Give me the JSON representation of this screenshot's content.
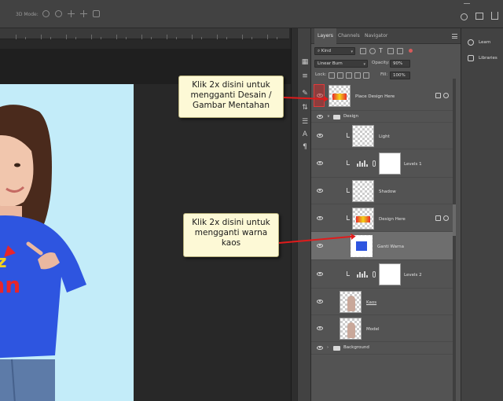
{
  "toolbar": {
    "mode_label": "3D Mode:"
  },
  "panel": {
    "tabs": [
      {
        "label": "Layers",
        "active": true
      },
      {
        "label": "Channels",
        "active": false
      },
      {
        "label": "Navigator",
        "active": false
      }
    ],
    "filter_label": "Kind",
    "blend_mode": "Linear Burn",
    "opacity_label": "Opacity:",
    "opacity_value": "90%",
    "lock_label": "Lock:",
    "fill_label": "Fill:",
    "fill_value": "100%"
  },
  "layers": [
    {
      "name": "Place Design Here",
      "type": "smart-object"
    },
    {
      "name": "Design",
      "type": "group"
    },
    {
      "name": "Light",
      "type": "raster"
    },
    {
      "name": "Levels 1",
      "type": "adjustment"
    },
    {
      "name": "Shadow",
      "type": "raster"
    },
    {
      "name": "Design Here",
      "type": "smart-object"
    },
    {
      "name": "Ganti Warna",
      "type": "fill",
      "selected": true
    },
    {
      "name": "Levels 2",
      "type": "adjustment"
    },
    {
      "name": "Kaos",
      "type": "raster"
    },
    {
      "name": "Model",
      "type": "raster"
    },
    {
      "name": "Background",
      "type": "group"
    }
  ],
  "side_panel": {
    "learn": "Learn",
    "libraries": "Libraries"
  },
  "callouts": {
    "design": "Klik 2x disini untuk mengganti Desain / Gambar Mentahan",
    "color": "Klik 2x disini untuk mengganti warna kaos"
  },
  "colors": {
    "callout_bg": "#fdf9d6",
    "arrow": "#e01b1b",
    "shirt": "#2e55e0",
    "canvas_bg": "#c3ecf9"
  }
}
